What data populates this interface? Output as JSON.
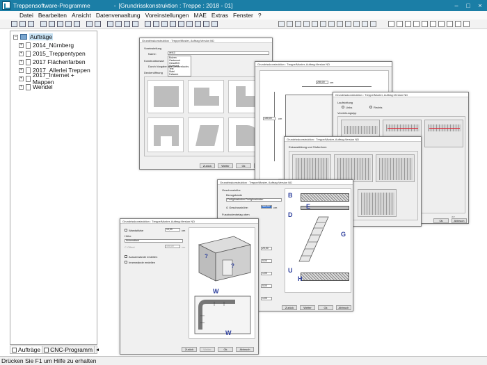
{
  "window": {
    "app_title": "Treppensoftware-Programme",
    "separator": "-",
    "doc_title": "[Grundrisskonstruktion : Treppe : 2018 - 01]",
    "controls": [
      "–",
      "□",
      "×"
    ]
  },
  "menu": [
    "Datei",
    "Bearbeiten",
    "Ansicht",
    "Datenverwaltung",
    "Voreinstellungen",
    "MAE",
    "Extras",
    "Fenster",
    "?"
  ],
  "tree": {
    "root": "Aufträge",
    "items": [
      "2014_Nürnberg",
      "2015_Treppentypen",
      "2017 Flächenfarben",
      "2017_Allerlei Treppen",
      "2017_Internet + Mappen",
      "Wendel"
    ]
  },
  "bottom_tabs": [
    "Aufträge",
    "CNC-Programm"
  ],
  "nav_arrows": [
    "◀",
    "▶"
  ],
  "status": "Drücken Sie  F1  um Hilfe zu erhalten",
  "dialogs": {
    "title": "Grundrisskonstruktion : Treppe/Muster, Auftrag:Version ND",
    "d1": {
      "voreinstellung": "Voreinstellung",
      "name_label": "Name:",
      "name_value": "ver10",
      "options": [
        "Bolzen",
        "Gestemmt",
        "Gewaffelt",
        "Standard",
        "Test",
        "Stahl",
        "Faltwerk"
      ],
      "konstruktionsart": "Konstruktionsart",
      "durch": "Durch Vorgabe des Deckenlochs",
      "deckenoeffnung": "Deckenöffnung",
      "buttons": [
        "Zurück",
        "Weiter",
        "Ok",
        "Abbruch"
      ],
      "more": ">>"
    },
    "d2": {
      "top_value": "280,00",
      "left_value": "150,00",
      "unit": "cm",
      "bottom_value": "110,0"
    },
    "d3": {
      "laufrichtung": "Laufrichtung",
      "links": "Links",
      "rechts": "Rechts",
      "verziehungstyp": "Verziehungstyp",
      "more": ">>",
      "buttons": [
        "Zurück",
        "Weiter",
        "Ok",
        "Abbruch"
      ]
    },
    "d4": {
      "label": "Eckausbildung und Stufenform",
      "more": ">>"
    },
    "d5": {
      "geschosshoehe": "Geschosshöhe",
      "bezugskante": "Bezugskante",
      "bezug_value": "Fertigfussboden-Fertigfussboden",
      "g_label": "G Geschosshöhe:",
      "g_value": "360,00",
      "unit": "cm",
      "fussbodenbelag": "Fussbodenbelag oben",
      "values": [
        "20,00",
        "5,00",
        "1,00",
        "5,00",
        "1,00"
      ],
      "letters": [
        "B",
        "E",
        "D",
        "G",
        "U",
        "H"
      ],
      "buttons": [
        "Zurück",
        "Weiter",
        "Ok",
        "Abbruch"
      ]
    },
    "d6": {
      "wandstaerke": "Wandstärke",
      "w_value": "10,00",
      "unit": "cm",
      "hoehe": "Höhe",
      "hoehe_value": "Automatisch",
      "offset_label": "C Offset",
      "offset_value": "100,00",
      "aussen": "Aussenwände erstellen",
      "innen": "Innenwände erstellen",
      "letters": [
        "W",
        "W"
      ],
      "qmarks": [
        "?",
        "?"
      ],
      "buttons": [
        "Zurück",
        "Weiter",
        "Ok",
        "Abbruch"
      ]
    }
  },
  "colors": {
    "titlebar": "#1b7ea6",
    "selection": "#c7e2f4",
    "letters": "#2c3e9c",
    "highlight": "#3a73c9"
  }
}
